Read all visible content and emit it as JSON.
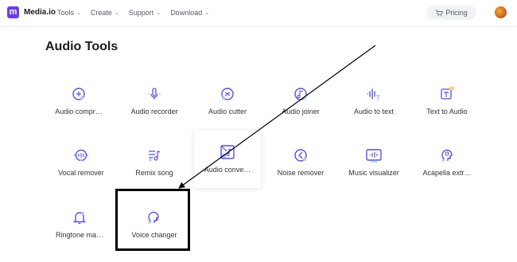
{
  "header": {
    "logo_letter": "m",
    "brand": "Media.io",
    "nav": [
      {
        "label": "Tools"
      },
      {
        "label": "Create"
      },
      {
        "label": "Support"
      },
      {
        "label": "Download"
      }
    ],
    "pricing_label": "Pricing"
  },
  "page_title": "Audio Tools",
  "tools": [
    {
      "label": "Audio compr…",
      "icon": "audio-compressor-icon"
    },
    {
      "label": "Audio recorder",
      "icon": "audio-recorder-icon"
    },
    {
      "label": "Audio cutter",
      "icon": "audio-cutter-icon"
    },
    {
      "label": "Audio joiner",
      "icon": "audio-joiner-icon"
    },
    {
      "label": "Audio to text",
      "icon": "audio-to-text-icon"
    },
    {
      "label": "Text to Audio",
      "icon": "text-to-audio-icon"
    },
    {
      "label": "Vocal remover",
      "icon": "vocal-remover-icon"
    },
    {
      "label": "Remix song",
      "icon": "remix-song-icon"
    },
    {
      "label": "Audio conve…",
      "icon": "audio-converter-icon"
    },
    {
      "label": "Noise remover",
      "icon": "noise-remover-icon"
    },
    {
      "label": "Music visualizer",
      "icon": "music-visualizer-icon"
    },
    {
      "label": "Acapella extr…",
      "icon": "acapella-extractor-icon"
    },
    {
      "label": "Ringtone ma…",
      "icon": "ringtone-maker-icon"
    },
    {
      "label": "Voice changer",
      "icon": "voice-changer-icon"
    }
  ],
  "colors": {
    "accent": "#6a3cf5",
    "icon_stroke": "#5b4cf0",
    "highlight_border": "#000000"
  }
}
